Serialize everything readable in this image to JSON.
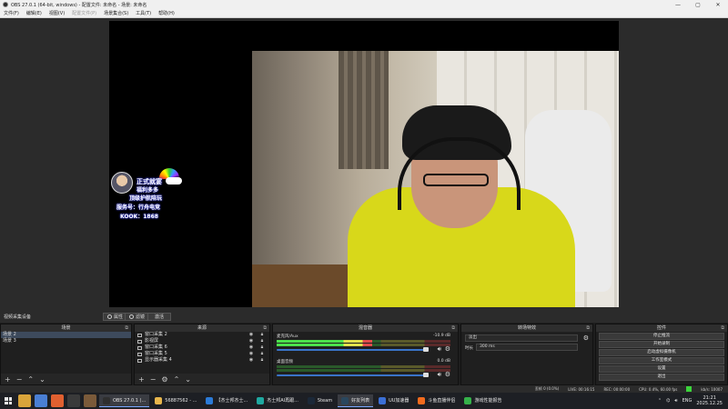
{
  "window": {
    "title": "OBS 27.0.1 (64-bit, windows) - 配置文件: 未命名 - 场景: 未命名"
  },
  "menu": [
    "文件(F)",
    "编辑(E)",
    "视图(V)",
    "配置文件(P)",
    "场景集合(S)",
    "工具(T)",
    "帮助(H)"
  ],
  "overlay": {
    "line1": "正式就宴",
    "line2": "福利多多",
    "line3": "顶级护航陪玩",
    "line4": "服务号：行舟电竞",
    "line5": "KOOK：1868"
  },
  "source_bar": {
    "label": "视频采集设备",
    "properties": "属性",
    "filters": "滤镜",
    "activate": "激活"
  },
  "scenes": {
    "title": "场景",
    "items": [
      "场景 2",
      "场景 3"
    ],
    "selected_index": 0
  },
  "sources": {
    "title": "来源",
    "items": [
      "窗口采集 2",
      "影视屏",
      "窗口采集 6",
      "窗口采集 5",
      "显示器采集 4"
    ]
  },
  "mixer": {
    "title": "混音器",
    "channels": [
      {
        "name": "麦克风/Aux",
        "db": "-10.9 dB",
        "level": 0.55,
        "volume": 0.97
      },
      {
        "name": "桌面音频",
        "db": "0.0 dB",
        "level": 0.0,
        "volume": 0.97
      }
    ]
  },
  "transitions": {
    "title": "转场特效",
    "type": "淡出",
    "duration_label": "时长",
    "duration": "300 ms"
  },
  "controls": {
    "title": "控件",
    "buttons": [
      "停止推流",
      "开始录制",
      "启动虚拟摄像机",
      "工作室模式",
      "设置",
      "退出"
    ]
  },
  "status": {
    "dropped": "丢帧 0 (0.0%)",
    "live": "LIVE: 00:16:15",
    "rec": "REC: 00:00:00",
    "cpu": "CPU: 0.4%, 60.00 fps",
    "bitrate": "kb/s: 10007"
  },
  "taskbar": {
    "items": [
      {
        "label": "OBS 27.0.1 (...",
        "color": "#2f2f2f",
        "active": true
      },
      {
        "label": "56887562 - ...",
        "color": "#e8b64c",
        "active": false
      },
      {
        "label": "【杰士邦杰士...",
        "color": "#2b7bd8",
        "active": false
      },
      {
        "label": "杰士邦AI再跟...",
        "color": "#1fa9a1",
        "active": false
      },
      {
        "label": "Steam",
        "color": "#1b2838",
        "active": false
      },
      {
        "label": "好友列表",
        "color": "#2a475e",
        "active": true
      },
      {
        "label": "UU加速器",
        "color": "#3b6fd6",
        "active": false
      },
      {
        "label": "斗鱼直播伴侣",
        "color": "#f26b1d",
        "active": false
      },
      {
        "label": "游戏性能报告",
        "color": "#35b24a",
        "active": false
      }
    ],
    "lang": "ENG",
    "time": "21:21",
    "date": "2025.12.25"
  }
}
